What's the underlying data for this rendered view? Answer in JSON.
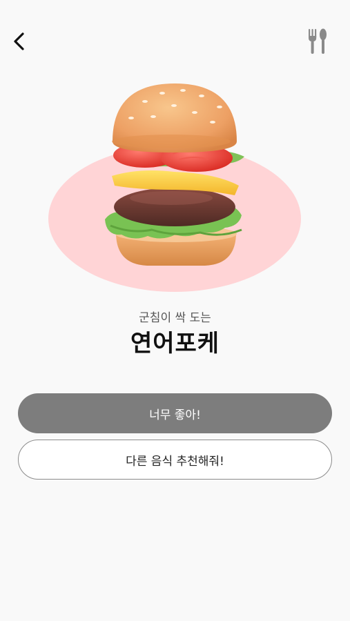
{
  "header": {
    "back_icon": "chevron-left-icon",
    "menu_icon": "fork-spoon-icon"
  },
  "hero": {
    "image": "hamburger-illustration",
    "backdrop_color": "#ffd4d6"
  },
  "recommendation": {
    "subtitle": "군침이 싹 도는",
    "food_name": "연어포케"
  },
  "actions": {
    "primary_label": "너무 좋아!",
    "secondary_label": "다른 음식 추천해줘!"
  },
  "colors": {
    "primary_button": "#7d7d7d",
    "background": "#f9f9f9"
  }
}
